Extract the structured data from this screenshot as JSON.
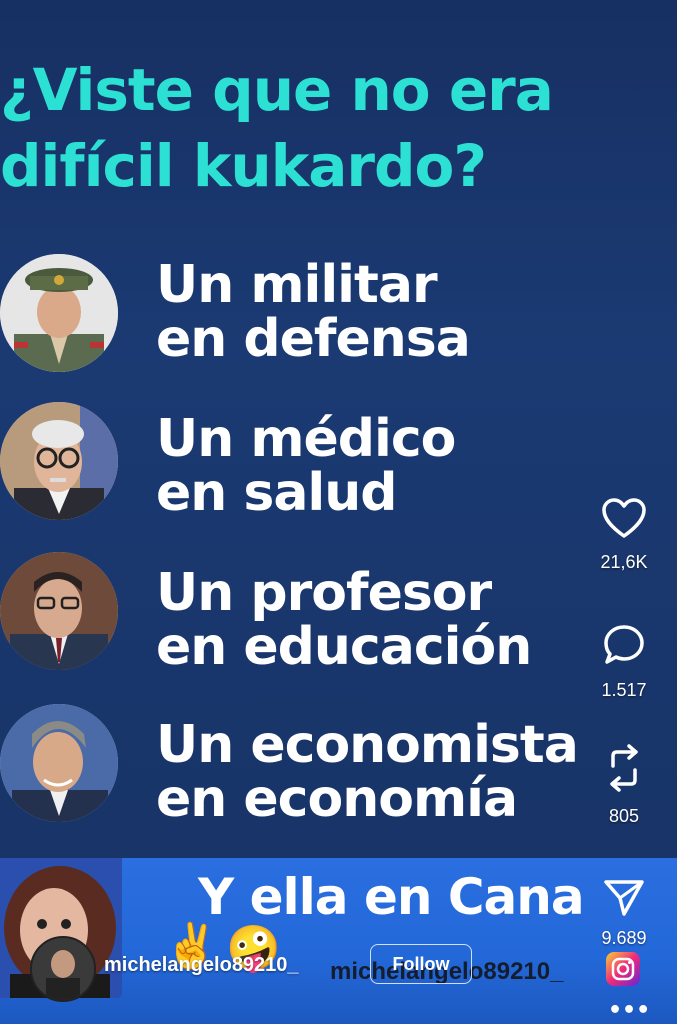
{
  "post": {
    "headline_line1": "¿Viste que no era",
    "headline_line2": "difícil kukardo?",
    "rows": [
      {
        "line1": "Un militar",
        "line2": "en defensa"
      },
      {
        "line1": "Un médico",
        "line2": "en salud"
      },
      {
        "line1": "Un profesor",
        "line2": "en educación"
      },
      {
        "line1": "Un economista",
        "line2": "en economía"
      }
    ]
  },
  "actions": {
    "likes": "21,6K",
    "comments": "1.517",
    "reposts": "805",
    "shares": "9.689"
  },
  "banner": {
    "text": "Y ella en Cana"
  },
  "creator": {
    "username": "michelangelo89210_",
    "follow_label": "Follow",
    "audio_label": "michelangelo89210_"
  },
  "colors": {
    "headline": "#2de0d4",
    "background": "#173063",
    "banner": "#2368d8"
  },
  "emojis": [
    "✌️",
    "🤪"
  ]
}
